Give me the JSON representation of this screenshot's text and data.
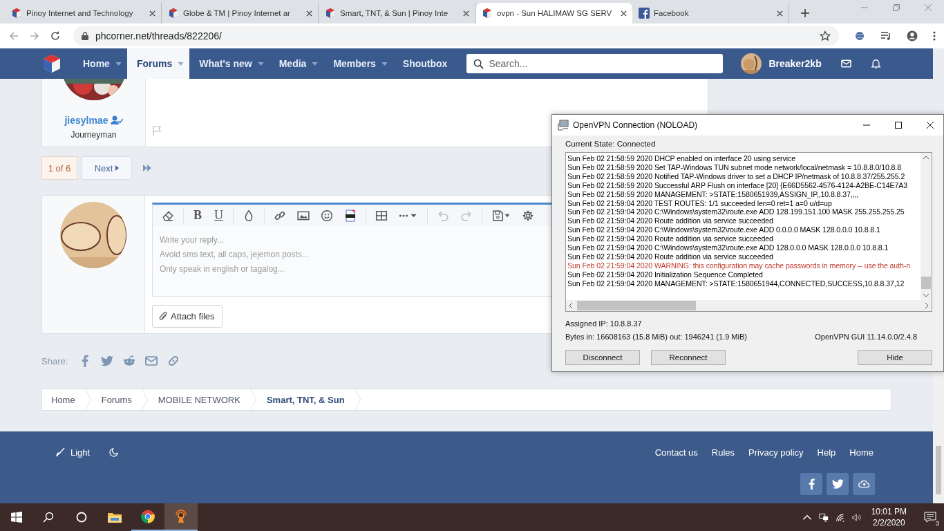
{
  "browser": {
    "tabs": [
      {
        "title": "Pinoy Internet and Technology",
        "selected": false
      },
      {
        "title": "Globe & TM | Pinoy Internet ar",
        "selected": false
      },
      {
        "title": "Smart, TNT, & Sun | Pinoy Inte",
        "selected": false
      },
      {
        "title": "ovpn - Sun HALIMAW SG SERV",
        "selected": true
      },
      {
        "title": "Facebook",
        "selected": false
      }
    ],
    "url": "phcorner.net/threads/822206/"
  },
  "forum_nav": {
    "items": [
      {
        "label": "Home",
        "selected": false,
        "has_menu": true
      },
      {
        "label": "Forums",
        "selected": true,
        "has_menu": true
      },
      {
        "label": "What's new",
        "selected": false,
        "has_menu": true
      },
      {
        "label": "Media",
        "selected": false,
        "has_menu": true
      },
      {
        "label": "Members",
        "selected": false,
        "has_menu": true
      },
      {
        "label": "Shoutbox",
        "selected": false,
        "has_menu": false
      }
    ],
    "search": {
      "placeholder": "Search..."
    },
    "username": "Breaker2kb"
  },
  "post": {
    "username": "jiesylmae",
    "rank": "Journeyman"
  },
  "pagination": {
    "current": "1 of 6",
    "next": "Next"
  },
  "editor": {
    "bold": "B",
    "underline": "U",
    "placeholder": "Write your reply...\nAvoid sms text, all caps, jejemon posts...\nOnly speak in english or tagalog...",
    "attach": "Attach files"
  },
  "share": {
    "label": "Share:"
  },
  "breadcrumb": [
    {
      "label": "Home",
      "current": false
    },
    {
      "label": "Forums",
      "current": false
    },
    {
      "label": "MOBILE NETWORK",
      "current": false
    },
    {
      "label": "Smart, TNT, & Sun",
      "current": true
    }
  ],
  "footer": {
    "style_label": "Light",
    "links": [
      "Contact us",
      "Rules",
      "Privacy policy",
      "Help",
      "Home"
    ]
  },
  "vpn": {
    "title": "OpenVPN Connection (NOLOAD)",
    "state": "Current State: Connected",
    "log": [
      {
        "text": "Sun Feb 02 21:58:59 2020 DHCP enabled on interface 20 using service",
        "kind": "info"
      },
      {
        "text": "Sun Feb 02 21:58:59 2020 Set TAP-Windows TUN subnet mode network/local/netmask = 10.8.8.0/10.8.8",
        "kind": "info"
      },
      {
        "text": "Sun Feb 02 21:58:59 2020 Notified TAP-Windows driver to set a DHCP IP/netmask of 10.8.8.37/255.255.2",
        "kind": "info"
      },
      {
        "text": "Sun Feb 02 21:58:59 2020 Successful ARP Flush on interface [20] {E66D5562-4576-4124-A2BE-C14E7A3",
        "kind": "info"
      },
      {
        "text": "Sun Feb 02 21:58:59 2020 MANAGEMENT: >STATE:1580651939,ASSIGN_IP,,10.8.8.37,,,,",
        "kind": "info"
      },
      {
        "text": "Sun Feb 02 21:59:04 2020 TEST ROUTES: 1/1 succeeded len=0 ret=1 a=0 u/d=up",
        "kind": "info"
      },
      {
        "text": "Sun Feb 02 21:59:04 2020 C:\\Windows\\system32\\route.exe ADD 128.199.151.100 MASK 255.255.255.25",
        "kind": "info"
      },
      {
        "text": "Sun Feb 02 21:59:04 2020 Route addition via service succeeded",
        "kind": "info"
      },
      {
        "text": "Sun Feb 02 21:59:04 2020 C:\\Windows\\system32\\route.exe ADD 0.0.0.0 MASK 128.0.0.0 10.8.8.1",
        "kind": "info"
      },
      {
        "text": "Sun Feb 02 21:59:04 2020 Route addition via service succeeded",
        "kind": "info"
      },
      {
        "text": "Sun Feb 02 21:59:04 2020 C:\\Windows\\system32\\route.exe ADD 128.0.0.0 MASK 128.0.0.0 10.8.8.1",
        "kind": "info"
      },
      {
        "text": "Sun Feb 02 21:59:04 2020 Route addition via service succeeded",
        "kind": "info"
      },
      {
        "text": "Sun Feb 02 21:59:04 2020 WARNING: this configuration may cache passwords in memory -- use the auth-n",
        "kind": "warning"
      },
      {
        "text": "Sun Feb 02 21:59:04 2020 Initialization Sequence Completed",
        "kind": "info"
      },
      {
        "text": "Sun Feb 02 21:59:04 2020 MANAGEMENT: >STATE:1580651944,CONNECTED,SUCCESS,10.8.8.37,12",
        "kind": "info"
      }
    ],
    "assigned_ip": "Assigned IP: 10.8.8.37",
    "bytes": "Bytes in: 16608163 (15.8 MiB)  out: 1946241 (1.9 MiB)",
    "version": "OpenVPN GUI 11.14.0.0/2.4.8",
    "buttons": [
      "Disconnect",
      "Reconnect",
      "Hide"
    ]
  },
  "taskbar": {
    "apps": [
      {
        "running": false,
        "active": false
      },
      {
        "running": true,
        "active": false
      },
      {
        "running": true,
        "active": true
      }
    ],
    "time": "10:01 PM",
    "date": "2/2/2020",
    "notifications": "3"
  }
}
